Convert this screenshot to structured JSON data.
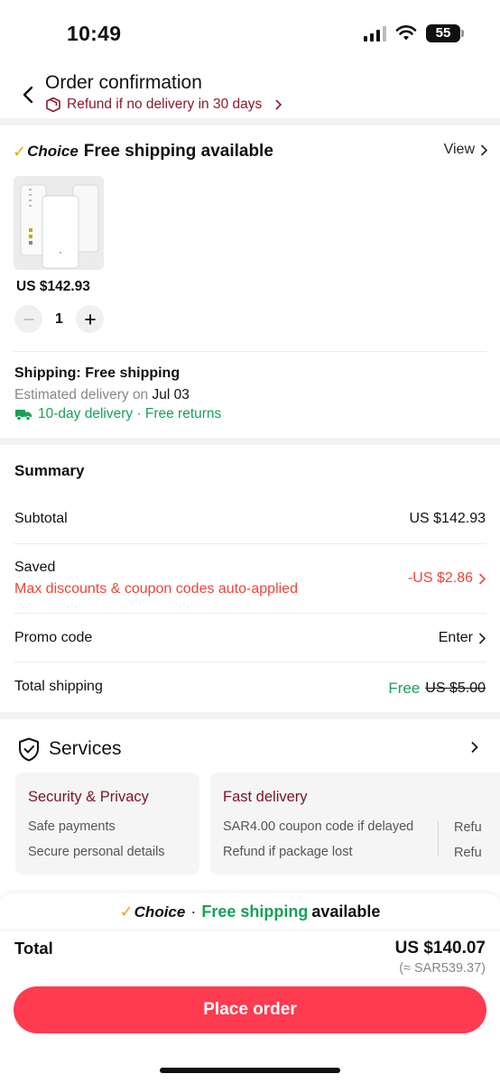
{
  "status_bar": {
    "time": "10:49",
    "battery": "55"
  },
  "header": {
    "title": "Order confirmation",
    "refund_text": "Refund if no delivery in 30 days"
  },
  "store": {
    "choice_label": "Choice",
    "free_shipping": "Free shipping available",
    "view_label": "View"
  },
  "product": {
    "price": "US $142.93",
    "quantity": "1"
  },
  "shipping": {
    "title": "Shipping: Free shipping",
    "estimated_prefix": "Estimated delivery on",
    "estimated_date": "Jul 03",
    "delivery_info": "10-day delivery · Free returns"
  },
  "summary": {
    "title": "Summary",
    "subtotal_label": "Subtotal",
    "subtotal_value": "US $142.93",
    "saved_label": "Saved",
    "saved_note": "Max discounts & coupon codes auto-applied",
    "saved_value": "-US $2.86",
    "promo_label": "Promo code",
    "promo_value": "Enter",
    "shipping_label": "Total shipping",
    "shipping_free": "Free",
    "shipping_original": "US $5.00"
  },
  "services": {
    "title": "Services",
    "cards": [
      {
        "title": "Security & Privacy",
        "items": [
          "Safe payments",
          "Secure personal details"
        ]
      },
      {
        "title": "Fast delivery",
        "items": [
          "SAR4.00 coupon code if delayed",
          "Refund if package lost"
        ],
        "extra": [
          "Refu",
          "Refu"
        ]
      }
    ]
  },
  "bottom": {
    "choice_label": "Choice",
    "separator": "·",
    "free_shipping": "Free shipping",
    "available": "available",
    "total_label": "Total",
    "total_value": "US $140.07",
    "total_sar": "(≈ SAR539.37)",
    "place_order": "Place order"
  },
  "colors": {
    "accent_red": "#ff3b50",
    "discount_red": "#f04438",
    "green": "#18a058",
    "choice_orange": "#f5a100",
    "refund_maroon": "#8a1c2c"
  }
}
